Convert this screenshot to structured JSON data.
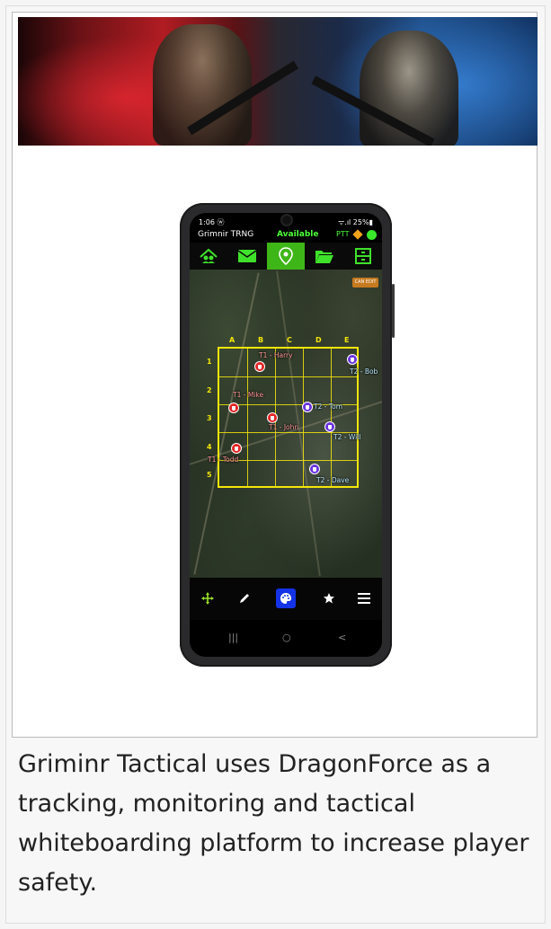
{
  "phone": {
    "statusbar": {
      "time": "1:06 ⓦ",
      "system": "ᯤ.ıl 25%▮"
    },
    "appbar": {
      "title": "Grimnir TRNG",
      "status": "Available",
      "ptt": "PTT"
    },
    "tabs": [
      {
        "icon": "team-icon",
        "active": false
      },
      {
        "icon": "mail-icon",
        "active": false
      },
      {
        "icon": "map-pin-icon",
        "active": true
      },
      {
        "icon": "folder-icon",
        "active": false
      },
      {
        "icon": "cabinet-icon",
        "active": false
      }
    ],
    "map": {
      "can_edit_label": "CAN EDIT",
      "grid": {
        "columns": [
          "A",
          "B",
          "C",
          "D",
          "E"
        ],
        "rows": [
          "1",
          "2",
          "3",
          "4",
          "5"
        ]
      },
      "players": [
        {
          "label": "T1 - Harry",
          "team": "T1"
        },
        {
          "label": "T2 - Bob",
          "team": "T2"
        },
        {
          "label": "T1 - Mike",
          "team": "T1"
        },
        {
          "label": "T2 - Tom",
          "team": "T2"
        },
        {
          "label": "T1 - John",
          "team": "T1"
        },
        {
          "label": "T2 - Will",
          "team": "T2"
        },
        {
          "label": "T1 - Todd",
          "team": "T1"
        },
        {
          "label": "T2 - Dave",
          "team": "T2"
        }
      ]
    },
    "toolbar": [
      "move-icon",
      "pencil-icon",
      "palette-icon",
      "star-icon",
      "menu-icon"
    ],
    "navbar": {
      "recents": "|||",
      "home": "○",
      "back": "<"
    }
  },
  "colors": {
    "grid": "#f5e609",
    "team1": "#e32626",
    "team2": "#6a33e0",
    "active_tab": "#3fb618",
    "active_tool": "#1433e8"
  },
  "caption": "Griminr Tactical uses DragonForce as a tracking, monitoring and tactical whiteboarding platform to increase player safety."
}
